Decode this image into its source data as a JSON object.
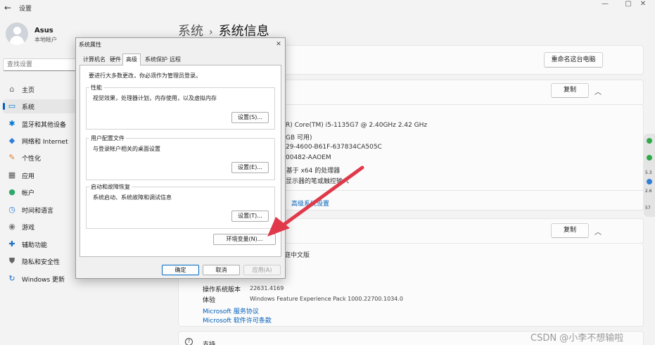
{
  "window": {
    "app_title": "设置",
    "back_glyph": "←",
    "minimize_glyph": "—",
    "maximize_glyph": "▢",
    "close_glyph": "✕"
  },
  "account": {
    "name": "Asus",
    "type": "本地帐户"
  },
  "search": {
    "placeholder": "查找设置"
  },
  "sidebar": {
    "items": [
      {
        "label": "主页",
        "icon": "home-icon",
        "glyph": "⌂",
        "color": "#6b6b6b"
      },
      {
        "label": "系统",
        "icon": "system-icon",
        "glyph": "▭",
        "color": "#0078d4"
      },
      {
        "label": "蓝牙和其他设备",
        "icon": "bluetooth-icon",
        "glyph": "✱",
        "color": "#0078d4"
      },
      {
        "label": "网络和 Internet",
        "icon": "network-icon",
        "glyph": "◆",
        "color": "#2f7fd8"
      },
      {
        "label": "个性化",
        "icon": "personalization-icon",
        "glyph": "✎",
        "color": "#d8832f"
      },
      {
        "label": "应用",
        "icon": "apps-icon",
        "glyph": "▦",
        "color": "#555555"
      },
      {
        "label": "帐户",
        "icon": "accounts-icon",
        "glyph": "●",
        "color": "#2fa86b"
      },
      {
        "label": "时间和语言",
        "icon": "time-language-icon",
        "glyph": "◷",
        "color": "#2f7fd8"
      },
      {
        "label": "游戏",
        "icon": "gaming-icon",
        "glyph": "◉",
        "color": "#777777"
      },
      {
        "label": "辅助功能",
        "icon": "accessibility-icon",
        "glyph": "✚",
        "color": "#1a6fc9"
      },
      {
        "label": "隐私和安全性",
        "icon": "privacy-icon",
        "glyph": "⛊",
        "color": "#666666"
      },
      {
        "label": "Windows 更新",
        "icon": "windows-update-icon",
        "glyph": "↻",
        "color": "#1a6fc9"
      }
    ]
  },
  "breadcrumb": {
    "parent": "系统",
    "separator": "›",
    "current": "系统信息"
  },
  "rename_button": "重命名这台电脑",
  "device_spec": {
    "copy_button": "复制",
    "lines": [
      "R) Core(TM) i5-1135G7 @ 2.40GHz   2.42 GHz",
      "GB 可用)",
      "29-4600-B61F-637834CA505C",
      "00482-AAOEM",
      ", 基于 x64 的处理器",
      "显示器的笔或触控输入"
    ],
    "related_link": "高级系统设置"
  },
  "windows_spec": {
    "copy_button": "复制",
    "edition_partial": "庭中文版",
    "rows": [
      {
        "label": "操作系统版本",
        "value": "22631.4169"
      },
      {
        "label": "体验",
        "value": "Windows Feature Experience Pack 1000.22700.1034.0"
      }
    ],
    "links": [
      "Microsoft 服务协议",
      "Microsoft 软件许可条款"
    ]
  },
  "support": {
    "label": "支持"
  },
  "side_widget": {
    "texts": [
      "5.3",
      "2.6",
      "57"
    ]
  },
  "dialog": {
    "title": "系统属性",
    "close_glyph": "✕",
    "tabs": [
      "计算机名",
      "硬件",
      "高级",
      "系统保护",
      "远程"
    ],
    "active_tab": "高级",
    "note": "要进行大多数更改，你必须作为管理员登录。",
    "groups": [
      {
        "title": "性能",
        "desc": "视觉效果，处理器计划，内存使用，以及虚拟内存",
        "button": "设置(S)..."
      },
      {
        "title": "用户配置文件",
        "desc": "与登录帐户相关的桌面设置",
        "button": "设置(E)..."
      },
      {
        "title": "启动和故障恢复",
        "desc": "系统启动、系统故障和调试信息",
        "button": "设置(T)..."
      }
    ],
    "env_button": "环境变量(N)...",
    "ok": "确定",
    "cancel": "取消",
    "apply": "应用(A)"
  },
  "colors": {
    "accent": "#005fb8",
    "arrow": "#e0394a"
  },
  "watermark": "CSDN @小李不想输啦"
}
